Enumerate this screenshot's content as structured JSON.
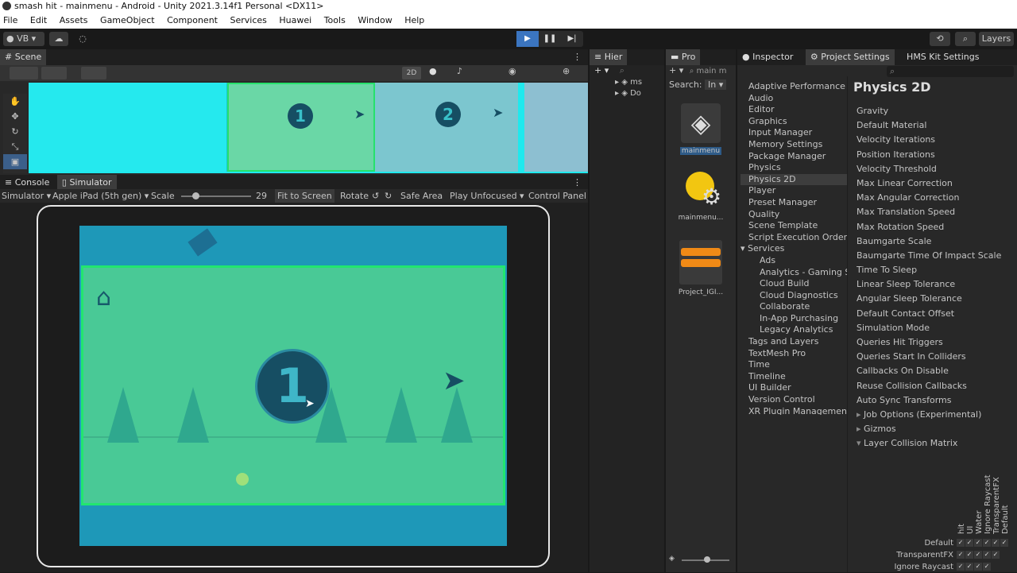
{
  "window": {
    "title": "smash hit - mainmenu - Android - Unity 2021.3.14f1 Personal <DX11>"
  },
  "menu": [
    "File",
    "Edit",
    "Assets",
    "GameObject",
    "Component",
    "Services",
    "Huawei",
    "Tools",
    "Window",
    "Help"
  ],
  "toolbar": {
    "account": "VB",
    "layers": "Layers"
  },
  "scene": {
    "tab": "Scene",
    "mode2d": "2D",
    "level1": "1",
    "level2": "2"
  },
  "bottom_tabs": {
    "console": "Console",
    "simulator": "Simulator"
  },
  "simulator": {
    "mode": "Simulator",
    "device": "Apple iPad (5th gen)",
    "scale_label": "Scale",
    "scale_value": "29",
    "fit": "Fit to Screen",
    "rotate": "Rotate",
    "safe_area": "Safe Area",
    "play_unfocused": "Play Unfocused",
    "control_panel": "Control Panel",
    "level_number": "1"
  },
  "hierarchy": {
    "tab": "Hier",
    "items": [
      "ms",
      "Do"
    ]
  },
  "project": {
    "tab": "Pro",
    "search_label": "Search:",
    "search_scope": "In",
    "search_value": "main m",
    "assets": [
      "mainmenu",
      "mainmenu...",
      "Project_IGI..."
    ]
  },
  "inspector_tabs": {
    "inspector": "Inspector",
    "project_settings": "Project Settings",
    "hms": "HMS Kit Settings"
  },
  "settings_list": [
    {
      "label": "Adaptive Performance",
      "indent": 0
    },
    {
      "label": "Audio",
      "indent": 0
    },
    {
      "label": "Editor",
      "indent": 0
    },
    {
      "label": "Graphics",
      "indent": 0
    },
    {
      "label": "Input Manager",
      "indent": 0
    },
    {
      "label": "Memory Settings",
      "indent": 0
    },
    {
      "label": "Package Manager",
      "indent": 0
    },
    {
      "label": "Physics",
      "indent": 0
    },
    {
      "label": "Physics 2D",
      "indent": 0,
      "selected": true
    },
    {
      "label": "Player",
      "indent": 0
    },
    {
      "label": "Preset Manager",
      "indent": 0
    },
    {
      "label": "Quality",
      "indent": 0
    },
    {
      "label": "Scene Template",
      "indent": 0
    },
    {
      "label": "Script Execution Order",
      "indent": 0
    },
    {
      "label": "Services",
      "indent": 0,
      "expanded": true
    },
    {
      "label": "Ads",
      "indent": 1
    },
    {
      "label": "Analytics - Gaming S",
      "indent": 1
    },
    {
      "label": "Cloud Build",
      "indent": 1
    },
    {
      "label": "Cloud Diagnostics",
      "indent": 1
    },
    {
      "label": "Collaborate",
      "indent": 1
    },
    {
      "label": "In-App Purchasing",
      "indent": 1
    },
    {
      "label": "Legacy Analytics",
      "indent": 1
    },
    {
      "label": "Tags and Layers",
      "indent": 0
    },
    {
      "label": "TextMesh Pro",
      "indent": 0
    },
    {
      "label": "Time",
      "indent": 0
    },
    {
      "label": "Timeline",
      "indent": 0
    },
    {
      "label": "UI Builder",
      "indent": 0
    },
    {
      "label": "Version Control",
      "indent": 0
    },
    {
      "label": "XR Plugin Management",
      "indent": 0
    }
  ],
  "physics2d": {
    "title": "Physics 2D",
    "fields": [
      "Gravity",
      "Default Material",
      "Velocity Iterations",
      "Position Iterations",
      "Velocity Threshold",
      "Max Linear Correction",
      "Max Angular Correction",
      "Max Translation Speed",
      "Max Rotation Speed",
      "Baumgarte Scale",
      "Baumgarte Time Of Impact Scale",
      "Time To Sleep",
      "Linear Sleep Tolerance",
      "Angular Sleep Tolerance",
      "Default Contact Offset",
      "Simulation Mode",
      "Queries Hit Triggers",
      "Queries Start In Colliders",
      "Callbacks On Disable",
      "Reuse Collision Callbacks",
      "Auto Sync Transforms"
    ],
    "foldouts": [
      "Job Options (Experimental)",
      "Gizmos",
      "Layer Collision Matrix"
    ],
    "matrix_columns": [
      "Default",
      "TransparentFX",
      "Ignore Raycast",
      "Water",
      "UI",
      "hit"
    ],
    "matrix_rows": [
      "Default",
      "TransparentFX",
      "Ignore Raycast"
    ],
    "check": "✓"
  }
}
